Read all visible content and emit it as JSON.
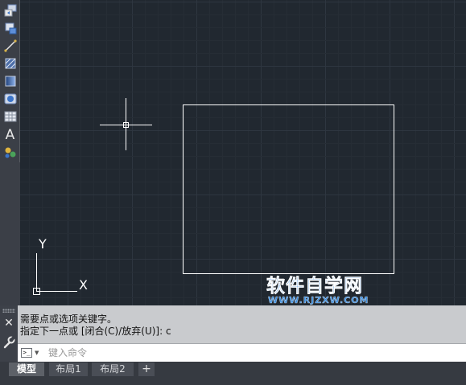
{
  "colors": {
    "canvas_background": "#212830",
    "grid_minor": "#262d35",
    "grid_major": "#2e3640",
    "drawing_lines": "#ffffff",
    "watermark_blue": "#2f7fd6"
  },
  "toolbar": {
    "items": [
      {
        "name": "insert-block-icon"
      },
      {
        "name": "make-block-icon"
      },
      {
        "name": "line-icon"
      },
      {
        "name": "hatch-icon"
      },
      {
        "name": "gradient-icon"
      },
      {
        "name": "region-icon"
      },
      {
        "name": "table-icon"
      },
      {
        "name": "multiline-text-icon",
        "label": "A"
      },
      {
        "name": "add-selected-icon"
      }
    ]
  },
  "viewport": {
    "ucs_y_label": "Y",
    "ucs_x_label": "X"
  },
  "watermark": {
    "title": "软件自学网",
    "url": "WWW.RJZXW.COM"
  },
  "command_line": {
    "close_label": "✕",
    "history": [
      "需要点或选项关键字。",
      "指定下一点或 [闭合(C)/放弃(U)]: c"
    ],
    "prompt_icon": ">_",
    "input_value": "",
    "input_placeholder": "键入命令"
  },
  "layout_tabs": {
    "tabs": [
      {
        "label": "模型",
        "active": true
      },
      {
        "label": "布局1",
        "active": false
      },
      {
        "label": "布局2",
        "active": false
      }
    ],
    "add_label": "+"
  }
}
